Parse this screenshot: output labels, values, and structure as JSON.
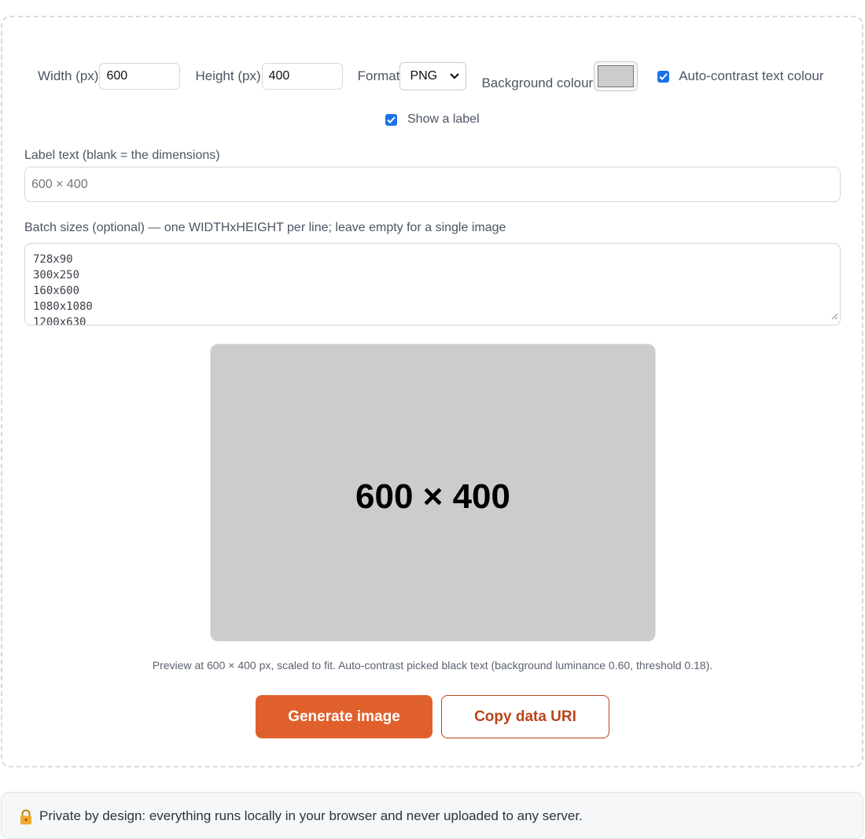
{
  "controls": {
    "width_label": "Width (px)",
    "width_value": "600",
    "height_label": "Height (px)",
    "height_value": "400",
    "format_label": "Format",
    "format_value": "PNG",
    "background_label": "Background colour",
    "background_color": "#cccccc",
    "autocontrast_label": "Auto-contrast text colour",
    "autocontrast_checked": true,
    "show_label_label": "Show a label",
    "show_label_checked": true
  },
  "label_field": {
    "label": "Label text (blank = the dimensions)",
    "placeholder": "600 × 400"
  },
  "batch_field": {
    "label": "Batch sizes (optional) — one WIDTHxHEIGHT per line; leave empty for a single image",
    "value": "728x90\n300x250\n160x600\n1080x1080\n1200x630"
  },
  "preview": {
    "label": "600 × 400",
    "background": "#cccccc",
    "text_color": "#000000",
    "caption": "Preview at 600 × 400 px, scaled to fit. Auto-contrast picked black text (background luminance 0.60, threshold 0.18)."
  },
  "buttons": {
    "generate_label": "Generate image",
    "copy_label": "Copy data URI"
  },
  "colors": {
    "accent": "#e0602c",
    "accent_dark": "#b9441a",
    "checkbox": "#1a73e8"
  },
  "footer": {
    "icon": "lock-icon",
    "text": "Private by design: everything runs locally in your browser and never uploaded to any server."
  }
}
